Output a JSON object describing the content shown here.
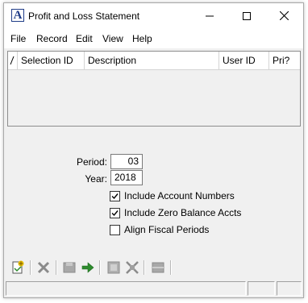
{
  "window": {
    "title": "Profit and Loss Statement",
    "app_icon_letter": "A"
  },
  "menu": [
    "File",
    "Record",
    "Edit",
    "View",
    "Help"
  ],
  "grid": {
    "columns": [
      "",
      "Selection ID",
      "Description",
      "User ID",
      "Pri?"
    ],
    "rows": []
  },
  "form": {
    "period_label": "Period:",
    "period_value": "03",
    "year_label": "Year:",
    "year_value": "2018",
    "checkboxes": [
      {
        "label": "Include Account Numbers",
        "checked": true
      },
      {
        "label": "Include Zero Balance Accts",
        "checked": true
      },
      {
        "label": "Align Fiscal Periods",
        "checked": false
      }
    ]
  },
  "toolbar": {
    "buttons": [
      "new-icon",
      "delete-icon",
      "save-icon",
      "run-icon",
      "grid-icon",
      "expand-icon",
      "list-icon"
    ]
  },
  "colors": {
    "accent": "#1f3c88",
    "window_bg": "#f0f0f0",
    "go_arrow": "#2e8b2e"
  }
}
